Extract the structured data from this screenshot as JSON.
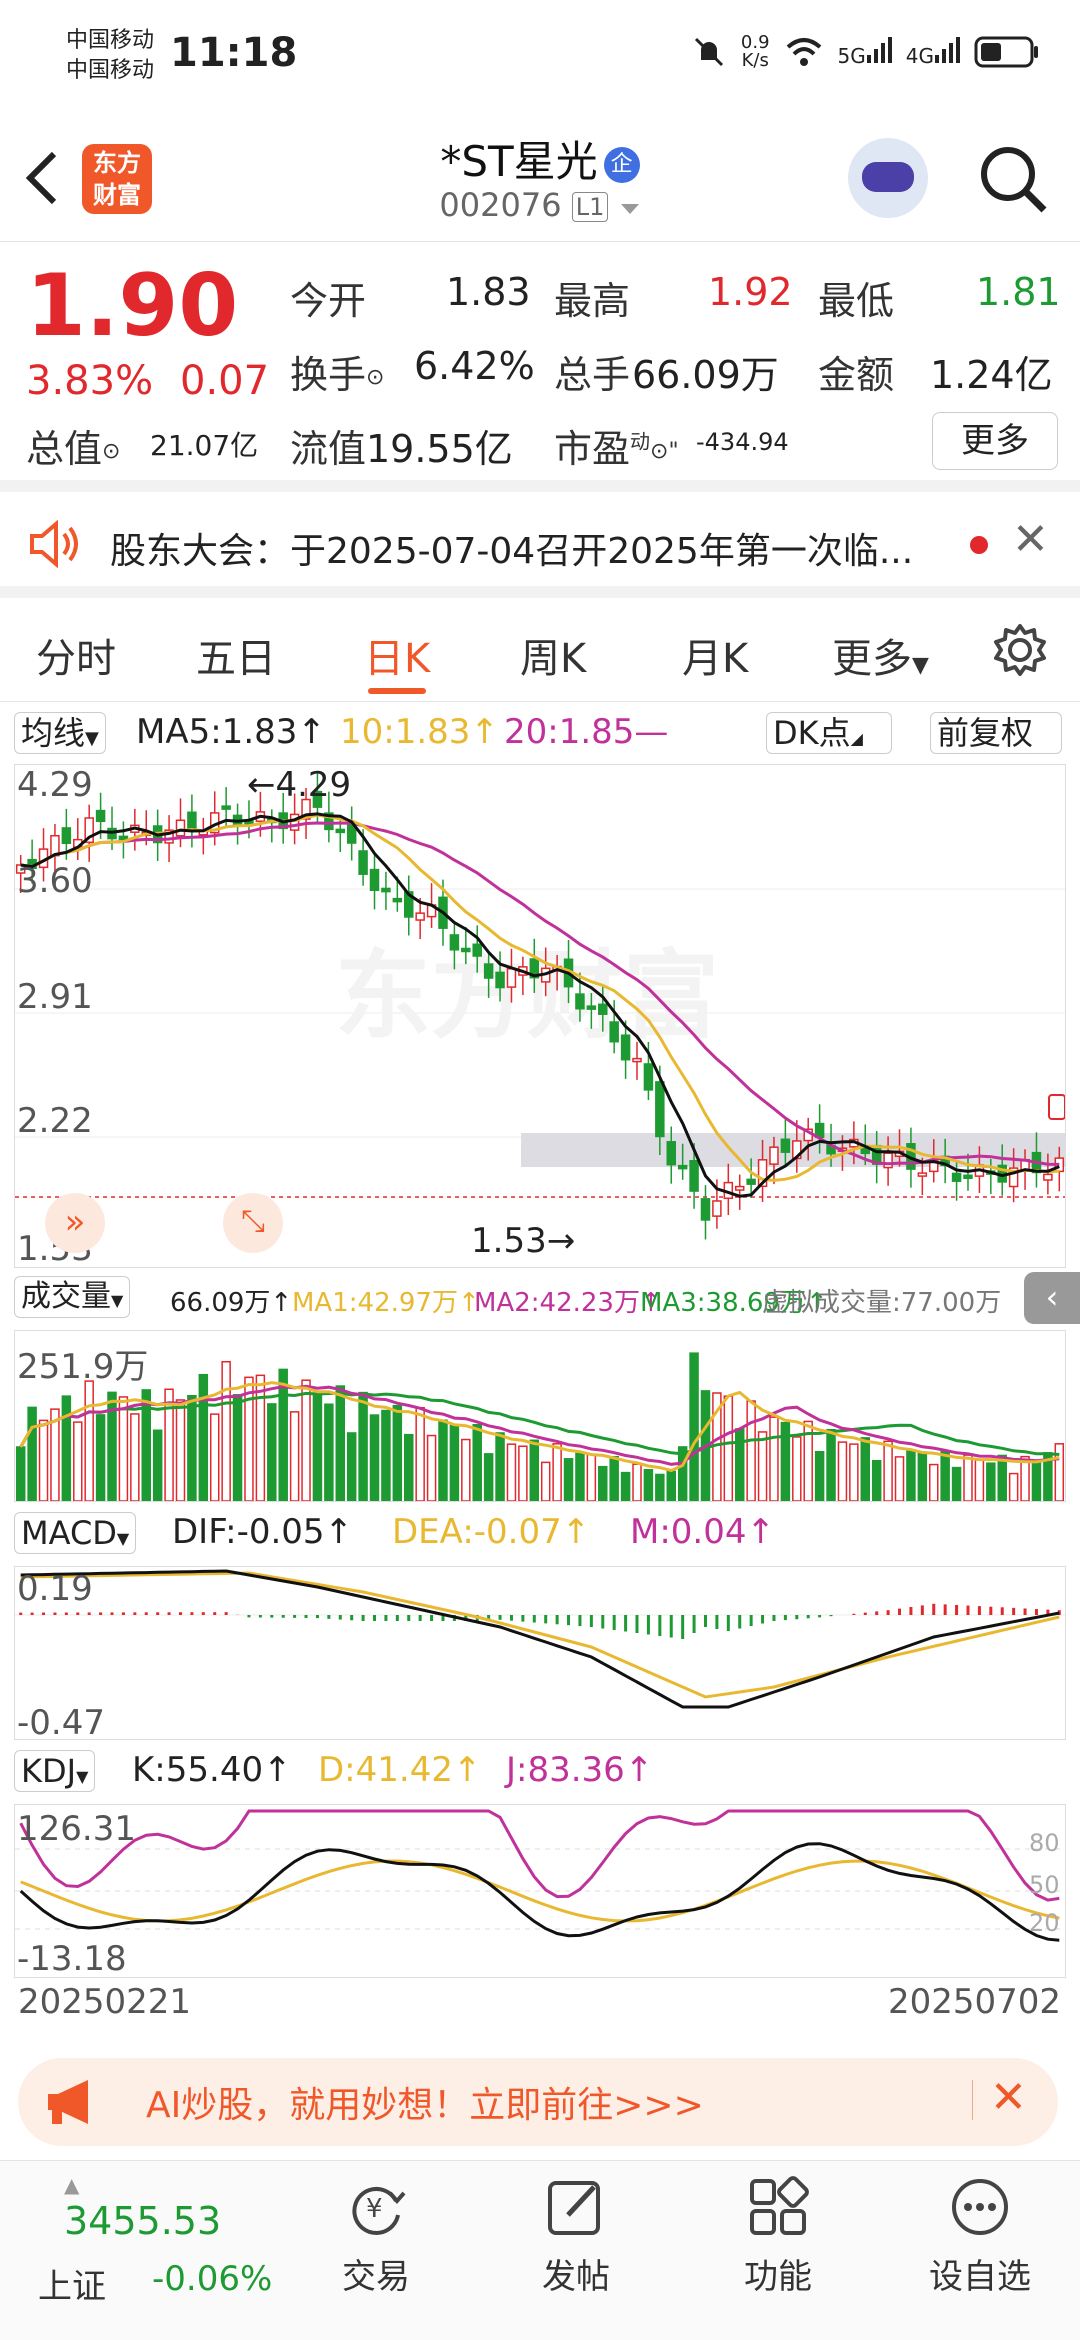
{
  "status_bar": {
    "carrier1": "中国移动",
    "carrier2": "中国移动",
    "time": "11:18",
    "net_speed": "0.9\nK/s",
    "net_speed_top": "0.9",
    "net_speed_bottom": "K/s",
    "sig5": "5G",
    "sig4": "4G"
  },
  "header": {
    "logo_line1": "东方",
    "logo_line2": "财富",
    "stock_name": "*ST星光",
    "badge": "企",
    "code": "002076",
    "level": "L1"
  },
  "quote": {
    "price": "1.90",
    "change_pct": "3.83%",
    "change": "0.07",
    "open_label": "今开",
    "open": "1.83",
    "high_label": "最高",
    "high": "1.92",
    "low_label": "最低",
    "low": "1.81",
    "turnover_label": "换手",
    "turnover": "6.42%",
    "volume_label": "总手",
    "volume": "66.09万",
    "amount_label": "金额",
    "amount": "1.24亿",
    "mktcap_label": "总值",
    "mktcap": "21.07亿",
    "float_label": "流值",
    "float": "19.55亿",
    "pe_label": "市盈",
    "pe_super": "动",
    "pe": "-434.94",
    "more": "更多"
  },
  "notice": {
    "text": "股东大会：于2025-07-04召开2025年第一次临..."
  },
  "tabs": [
    {
      "label": "分时"
    },
    {
      "label": "五日"
    },
    {
      "label": "日K"
    },
    {
      "label": "周K"
    },
    {
      "label": "月K"
    },
    {
      "label": "更多"
    }
  ],
  "kline": {
    "ma_select": "均线",
    "ma5": "MA5:1.83↑",
    "ma10": "10:1.83↑",
    "ma20": "20:1.85—",
    "dk": "DK点",
    "fq": "前复权",
    "y_labels": [
      "4.29",
      "3.60",
      "2.91",
      "2.22",
      "1.53"
    ],
    "max_marker": "←4.29",
    "min_marker": "1.53→",
    "watermark": "东方财富"
  },
  "volume": {
    "select": "成交量",
    "vol": "66.09万↑",
    "ma1": "MA1:42.97万↑",
    "ma2": "MA2:42.23万↑",
    "ma3": "MA3:38.69万↑",
    "virtual": "虚拟成交量:77.00万",
    "max_label": "251.9万"
  },
  "macd": {
    "select": "MACD",
    "dif": "DIF:-0.05↑",
    "dea": "DEA:-0.07↑",
    "m": "M:0.04↑",
    "top": "0.19",
    "bottom": "-0.47"
  },
  "kdj": {
    "select": "KDJ",
    "k": "K:55.40↑",
    "d": "D:41.42↑",
    "j": "J:83.36↑",
    "top": "126.31",
    "bottom": "-13.18",
    "r80": "80",
    "r50": "50",
    "r20": "20"
  },
  "dates": {
    "start": "20250221",
    "end": "20250702"
  },
  "ad": {
    "text": "AI炒股，就用妙想！立即前往>>>"
  },
  "bottom_nav": {
    "index_value": "3455.53",
    "index_name": "上证",
    "index_change": "-0.06%",
    "items": [
      {
        "label": "交易"
      },
      {
        "label": "发帖"
      },
      {
        "label": "功能"
      },
      {
        "label": "设自选"
      }
    ]
  },
  "colors": {
    "up": "#e0282d",
    "down": "#1e9a32",
    "accent": "#f0582a",
    "ma5": "#111111",
    "ma10": "#e8b830",
    "ma20": "#c0319a"
  }
}
